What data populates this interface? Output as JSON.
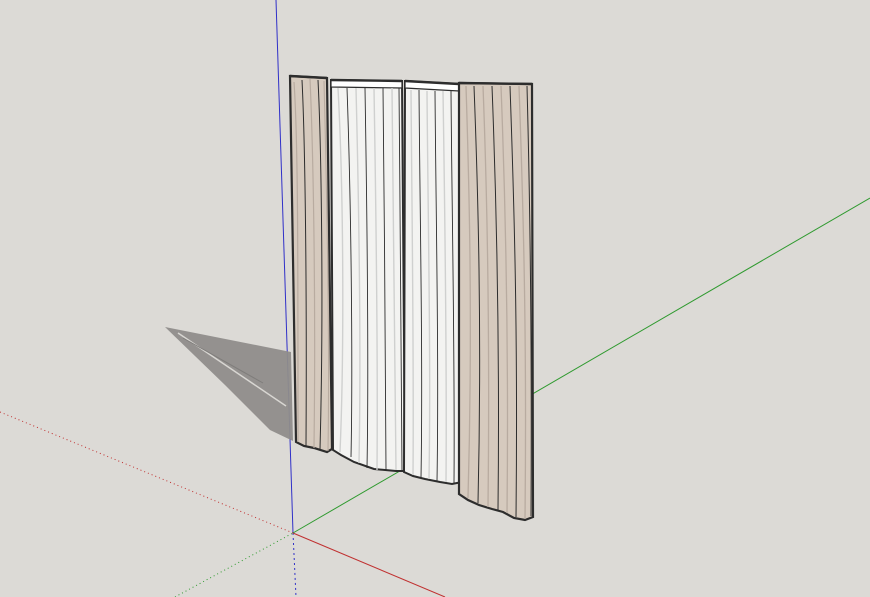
{
  "scene": {
    "background": "#dcdad6",
    "axis_colors": {
      "red": "#c03030",
      "green": "#2f9a2f",
      "blue": "#3030c8"
    },
    "curtain_colors": {
      "drape": "#d6cabe",
      "drape_shadow": "#b8aba0",
      "sheer": "#f3f3f1",
      "sheer_shadow": "#cfd0cf",
      "outline": "#2d2d2d",
      "ground_shadow": "#8f8d8b"
    }
  }
}
